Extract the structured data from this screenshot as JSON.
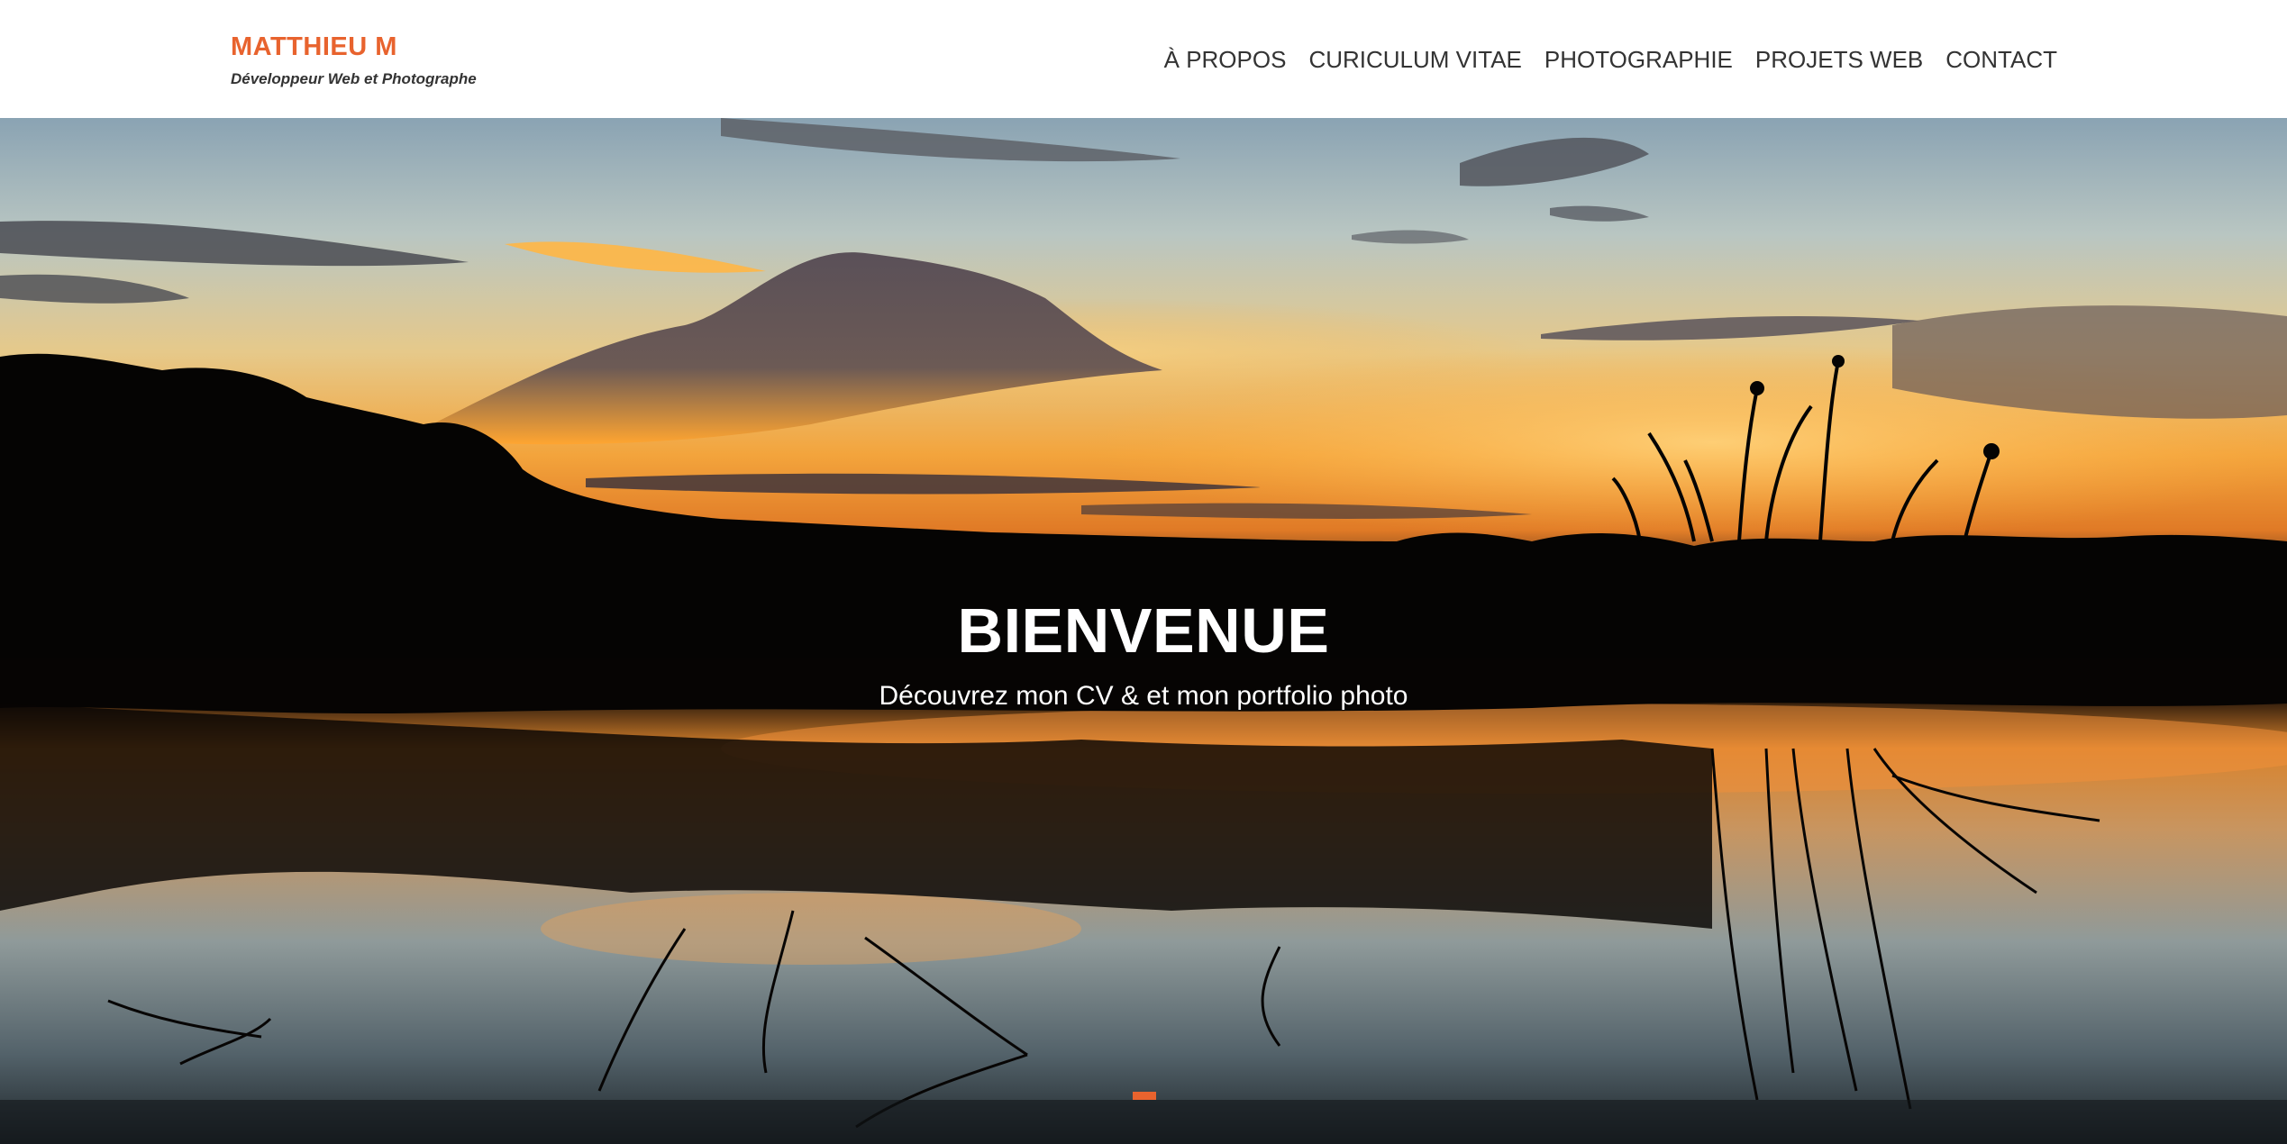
{
  "header": {
    "brand_name": "MATTHIEU M",
    "tagline": "Développeur Web et Photographe",
    "nav": [
      {
        "label": "À PROPOS"
      },
      {
        "label": "CURICULUM VITAE"
      },
      {
        "label": "PHOTOGRAPHIE"
      },
      {
        "label": "PROJETS WEB"
      },
      {
        "label": "CONTACT"
      }
    ]
  },
  "hero": {
    "title": "BIENVENUE",
    "subtitle": "Découvrez mon CV & et mon portfolio photo",
    "background_image": "sunset-lake-photo"
  },
  "colors": {
    "accent": "#e8632e",
    "header_bg": "#ffffff",
    "nav_text": "#333333"
  }
}
